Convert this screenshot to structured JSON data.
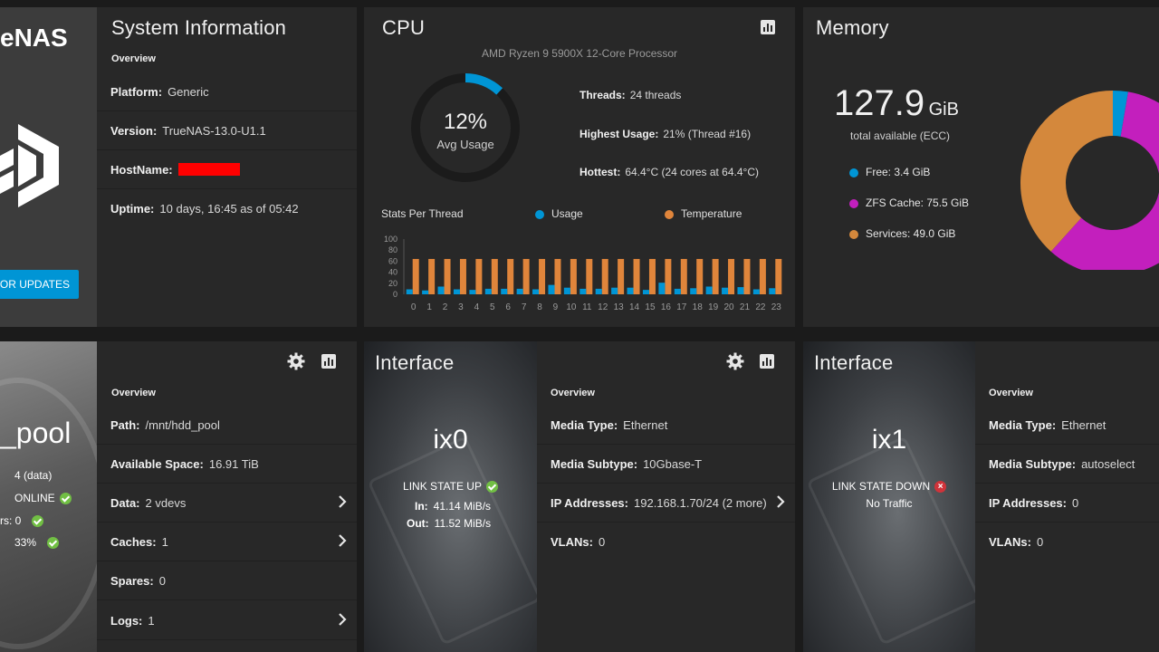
{
  "system": {
    "logo_text": "eNAS",
    "update_button": "OR UPDATES",
    "title": "System Information",
    "overview": "Overview",
    "rows": [
      {
        "label": "Platform:",
        "value": "Generic"
      },
      {
        "label": "Version:",
        "value": "TrueNAS-13.0-U1.1"
      },
      {
        "label": "HostName:",
        "value": ""
      },
      {
        "label": "Uptime:",
        "value": "10 days, 16:45 as of 05:42"
      }
    ]
  },
  "cpu": {
    "title": "CPU",
    "model": "AMD Ryzen 9 5900X 12-Core Processor",
    "avg_value": "12%",
    "avg_label": "Avg Usage",
    "avg_fraction": 0.12,
    "threads": {
      "label": "Threads:",
      "value": "24 threads"
    },
    "highest": {
      "label": "Highest Usage:",
      "value": "21%  (Thread #16)"
    },
    "hottest": {
      "label": "Hottest:",
      "value": "64.4°C  (24 cores at 64.4°C)"
    },
    "stats_label": "Stats Per Thread",
    "legend_usage": "Usage",
    "legend_temp": "Temperature",
    "colors": {
      "usage": "#0095d5",
      "temperature": "#e0853b"
    }
  },
  "chart_data": {
    "type": "bar",
    "categories": [
      "0",
      "1",
      "2",
      "3",
      "4",
      "5",
      "6",
      "7",
      "8",
      "9",
      "10",
      "11",
      "12",
      "13",
      "14",
      "15",
      "16",
      "17",
      "18",
      "19",
      "20",
      "21",
      "22",
      "23"
    ],
    "series": [
      {
        "name": "Usage",
        "values": [
          9,
          7,
          14,
          9,
          8,
          10,
          10,
          10,
          9,
          17,
          12,
          10,
          10,
          12,
          12,
          8,
          21,
          10,
          11,
          14,
          12,
          13,
          9,
          11
        ]
      },
      {
        "name": "Temperature",
        "values": [
          64,
          64,
          64,
          64,
          64,
          64,
          64,
          64,
          64,
          64,
          64,
          64,
          64,
          64,
          64,
          64,
          64,
          64,
          64,
          64,
          64,
          64,
          64,
          64
        ]
      }
    ],
    "yticks": [
      "100",
      "80",
      "60",
      "40",
      "20",
      "0"
    ],
    "ylim": [
      0,
      100
    ]
  },
  "memory": {
    "title": "Memory",
    "total_value": "127.9",
    "total_unit": "GiB",
    "total_label": "total available (ECC)",
    "free": "Free: 3.4 GiB",
    "zfs": "ZFS Cache: 75.5 GiB",
    "services": "Services: 49.0 GiB",
    "colors": {
      "free": "#0095d5",
      "zfs": "#c31fbd",
      "services": "#d4883c"
    },
    "values": [
      3.4,
      75.5,
      49.0
    ]
  },
  "pool": {
    "name": "_pool",
    "disks": "4 (data)",
    "status": "ONLINE",
    "errors_label": "rs: 0",
    "used": "33%",
    "overview": "Overview",
    "rows": [
      {
        "label": "Path:",
        "value": "/mnt/hdd_pool"
      },
      {
        "label": "Available Space:",
        "value": "16.91 TiB"
      },
      {
        "label": "Data:",
        "value": "2 vdevs"
      },
      {
        "label": "Caches:",
        "value": "1"
      },
      {
        "label": "Spares:",
        "value": "0"
      },
      {
        "label": "Logs:",
        "value": "1"
      }
    ]
  },
  "iface0": {
    "title": "Interface",
    "name": "ix0",
    "state": "LINK STATE UP",
    "in_label": "In:",
    "in_value": "41.14 MiB/s",
    "out_label": "Out:",
    "out_value": "11.52 MiB/s",
    "overview": "Overview",
    "rows": [
      {
        "label": "Media Type:",
        "value": "Ethernet"
      },
      {
        "label": "Media Subtype:",
        "value": "10Gbase-T"
      },
      {
        "label": "IP Addresses:",
        "value": "192.168.1.70/24  (2 more)"
      },
      {
        "label": "VLANs:",
        "value": "0"
      }
    ]
  },
  "iface1": {
    "title": "Interface",
    "name": "ix1",
    "state": "LINK STATE DOWN",
    "traffic": "No Traffic",
    "overview": "Overview",
    "rows": [
      {
        "label": "Media Type:",
        "value": "Ethernet"
      },
      {
        "label": "Media Subtype:",
        "value": "autoselect"
      },
      {
        "label": "IP Addresses:",
        "value": "0"
      },
      {
        "label": "VLANs:",
        "value": "0"
      }
    ]
  }
}
